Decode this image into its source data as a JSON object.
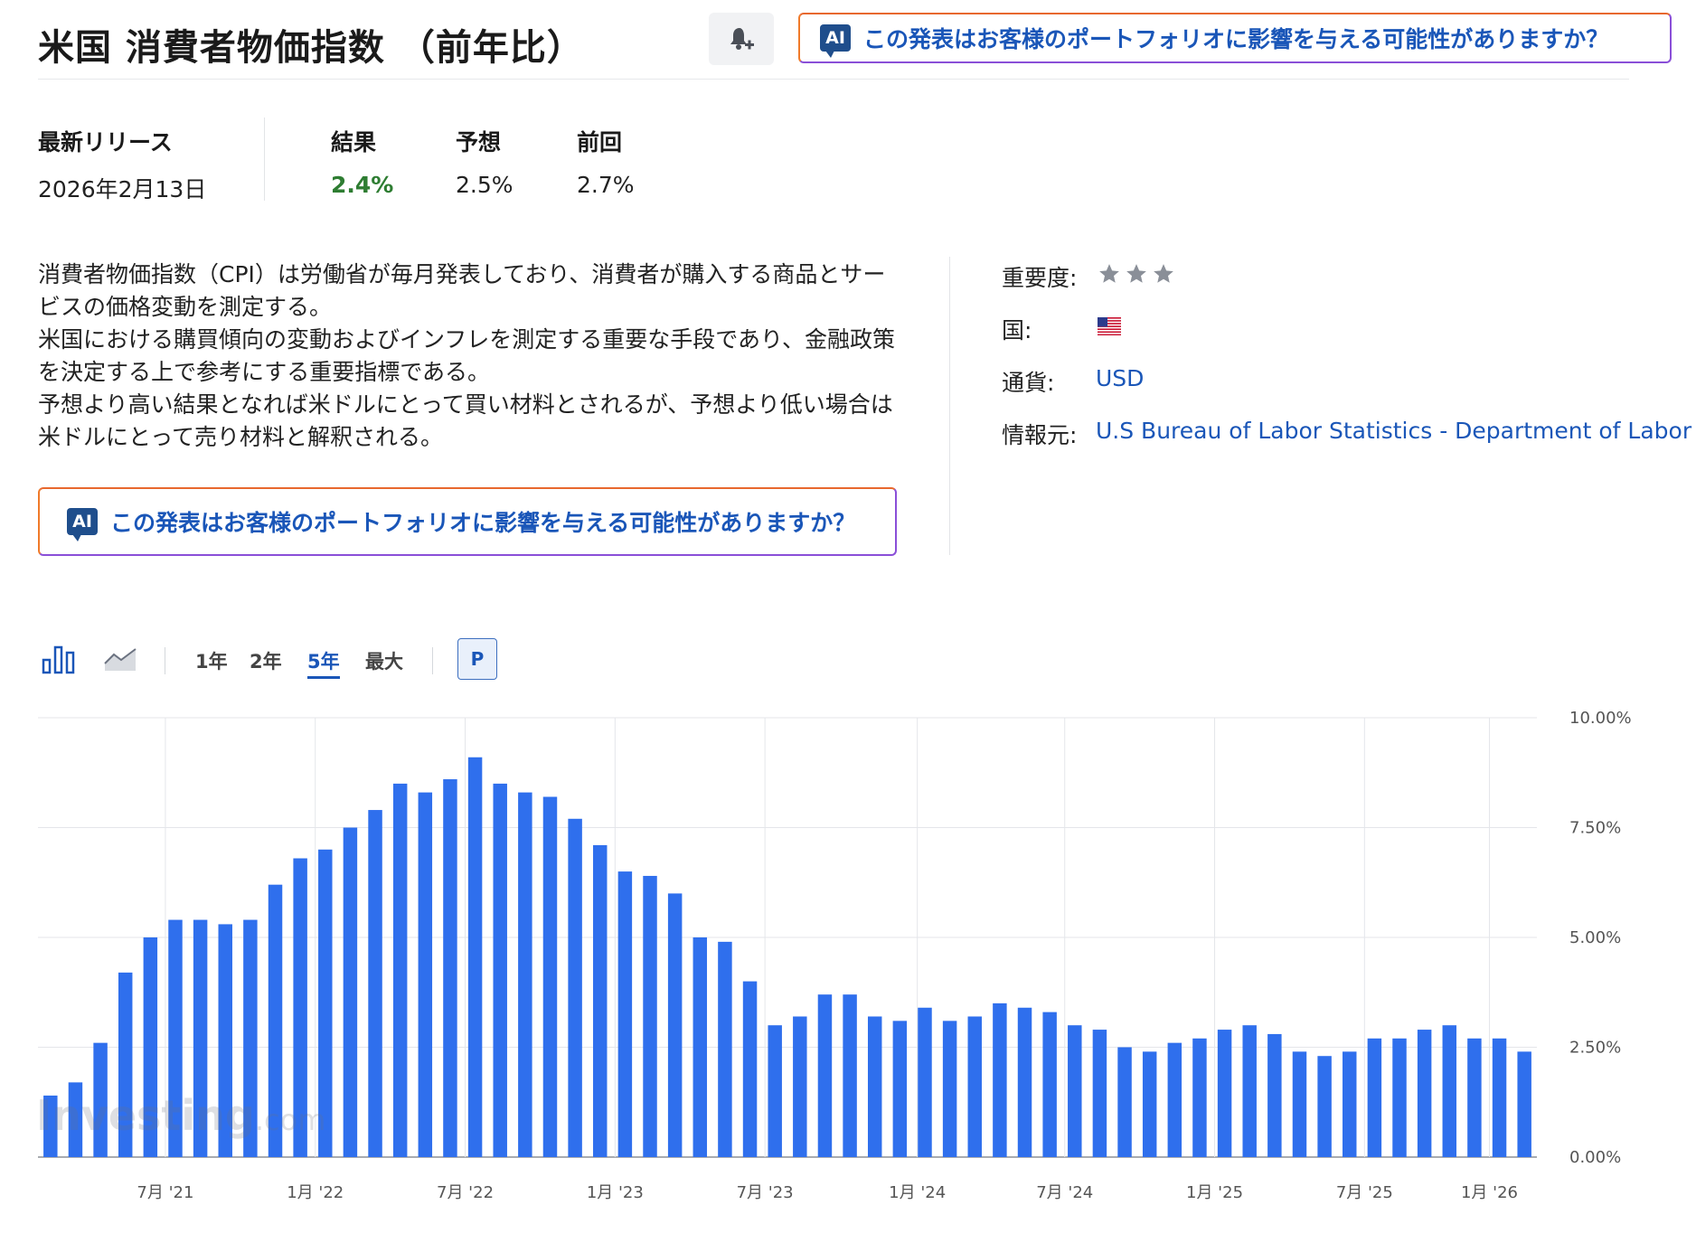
{
  "header": {
    "title": "米国 消費者物価指数 （前年比）",
    "ai_prompt": "この発表はお客様のポートフォリオに影響を与える可能性がありますか？",
    "ai_badge": "AI"
  },
  "release": {
    "latest_label": "最新リリース",
    "latest_date": "2026年2月13日",
    "actual_label": "結果",
    "actual_value": "2.4%",
    "forecast_label": "予想",
    "forecast_value": "2.5%",
    "previous_label": "前回",
    "previous_value": "2.7%"
  },
  "description": [
    "消費者物価指数（CPI）は労働省が毎月発表しており、消費者が購入する商品とサービスの価格変動を測定する。",
    "米国における購買傾向の変動およびインフレを測定する重要な手段であり、金融政策を決定する上で参考にする重要指標である。",
    "予想より高い結果となれば米ドルにとって買い材料とされるが、予想より低い場合は米ドルにとって売り材料と解釈される。"
  ],
  "meta": {
    "importance_label": "重要度:",
    "importance_stars": 3,
    "country_label": "国:",
    "country_flag": "us-flag-icon",
    "currency_label": "通貨:",
    "currency_value": "USD",
    "source_label": "情報元:",
    "source_value": "U.S Bureau of Labor Statistics - Department of Labor"
  },
  "toolbar": {
    "ranges": [
      "1年",
      "2年",
      "5年",
      "最大"
    ],
    "active_range": "5年",
    "p_label": "P"
  },
  "colors": {
    "bar": "#2f6fed",
    "actual_value": "#2e7d32",
    "link": "#1a56b8"
  },
  "watermark": {
    "text": "Investing",
    "suffix": ".com"
  },
  "chart_data": {
    "type": "bar",
    "ylim": [
      0,
      10
    ],
    "yticks": [
      "0.00%",
      "2.50%",
      "5.00%",
      "7.50%",
      "10.00%"
    ],
    "x_tick_labels": [
      "7月 '21",
      "1月 '22",
      "7月 '22",
      "1月 '23",
      "7月 '23",
      "1月 '24",
      "7月 '24",
      "1月 '25",
      "7月 '25",
      "1月 '26"
    ],
    "x_tick_bar_index": [
      4.6,
      10.6,
      16.6,
      22.6,
      28.6,
      34.7,
      40.6,
      46.6,
      52.6,
      57.6
    ],
    "values": [
      1.4,
      1.7,
      2.6,
      4.2,
      5.0,
      5.4,
      5.4,
      5.3,
      5.4,
      6.2,
      6.8,
      7.0,
      7.5,
      7.9,
      8.5,
      8.3,
      8.6,
      9.1,
      8.5,
      8.3,
      8.2,
      7.7,
      7.1,
      6.5,
      6.4,
      6.0,
      5.0,
      4.9,
      4.0,
      3.0,
      3.2,
      3.7,
      3.7,
      3.2,
      3.1,
      3.4,
      3.1,
      3.2,
      3.5,
      3.4,
      3.3,
      3.0,
      2.9,
      2.5,
      2.4,
      2.6,
      2.7,
      2.9,
      3.0,
      2.8,
      2.4,
      2.3,
      2.4,
      2.7,
      2.7,
      2.9,
      3.0,
      2.7,
      2.7,
      2.4
    ],
    "grid": true
  }
}
